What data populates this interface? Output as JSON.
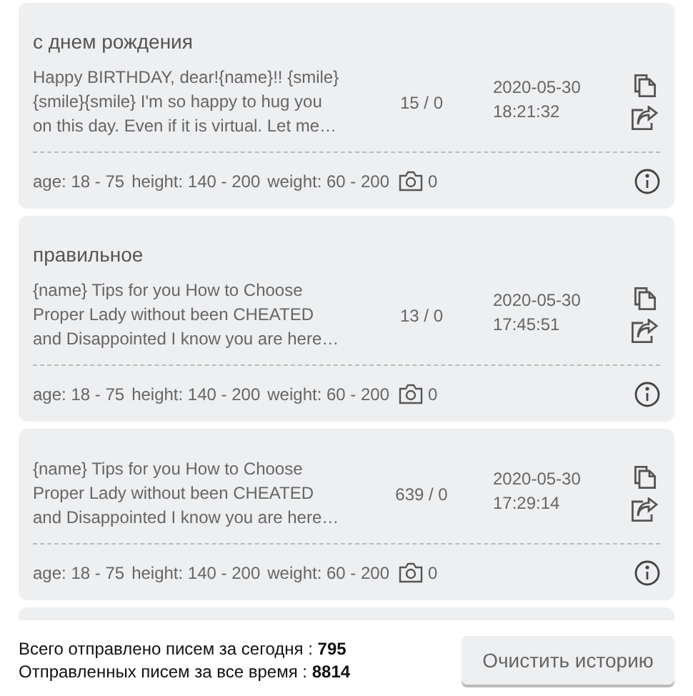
{
  "messages": [
    {
      "title": "с днем рождения",
      "text": "Happy BIRTHDAY, dear!{name}!! {smile}\n{smile}{smile} I'm so happy to hug you\non this day. Even if it is virtual. Let me…",
      "count": "15 / 0",
      "datetime": "2020-05-30\n18:21:32",
      "filters": [
        "age: 18 - 75",
        "height: 140 - 200",
        "weight: 60 - 200"
      ],
      "photos": "0"
    },
    {
      "title": "правильное",
      "text": "{name} Tips for you How to Choose\nProper Lady without been CHEATED\nand Disappointed I know you are here…",
      "count": "13 / 0",
      "datetime": "2020-05-30\n17:45:51",
      "filters": [
        "age: 18 - 75",
        "height: 140 - 200",
        "weight: 60 - 200"
      ],
      "photos": "0"
    },
    {
      "text": "{name} Tips for you How to Choose\nProper Lady without been CHEATED\nand Disappointed I know you are here…",
      "count": "639 / 0",
      "datetime": "2020-05-30\n17:29:14",
      "filters": [
        "age: 18 - 75",
        "height: 140 - 200",
        "weight: 60 - 200"
      ],
      "photos": "0"
    }
  ],
  "stats": [
    "Всего отправлено писем за сегодня : **795**",
    "Отправленных писем за все время : **8814**"
  ],
  "clear_button": "Очистить историю"
}
